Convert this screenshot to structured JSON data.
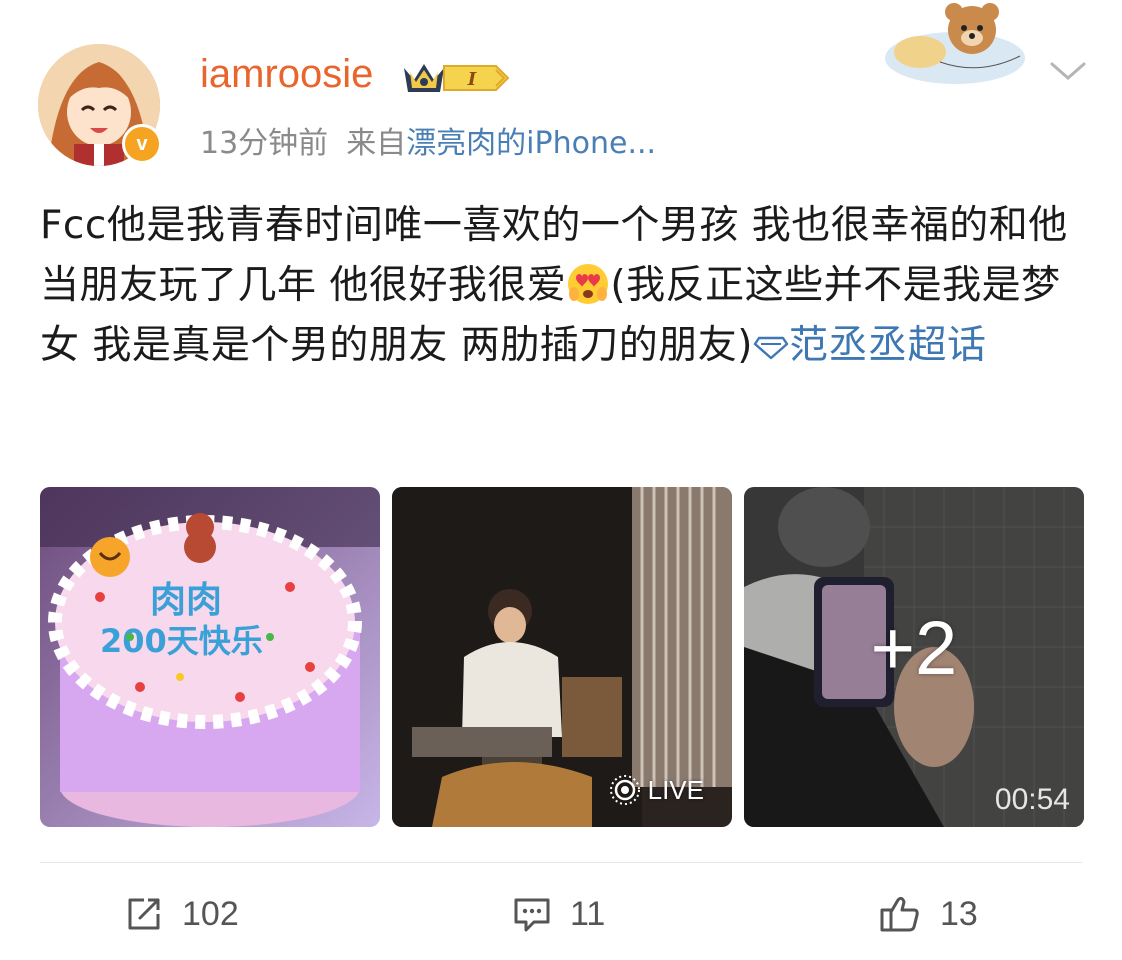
{
  "user": {
    "name": "iamroosie",
    "badge_level": "I",
    "time": "13分钟前",
    "source_prefix": "来自",
    "source_device": "漂亮肉的iPhone..."
  },
  "post": {
    "text_main": "Fcc他是我青春时间唯一喜欢的一个男孩 我也很幸福的和他当朋友玩了几年  他很好我很爱",
    "text_after_emoji": "(我反正这些并不是我是梦女 我是真是个男的朋友 两肋插刀的朋友)",
    "topic": "范丞丞超话"
  },
  "images": {
    "cake_text_line1": "肉肉",
    "cake_text_line2": "200天快乐",
    "live_label": "LIVE",
    "more_count": "+2",
    "video_duration": "00:54"
  },
  "actions": {
    "repost_count": "102",
    "comment_count": "11",
    "like_count": "13"
  },
  "icons": {
    "avatar": "anime-girl-avatar",
    "verified": "orange-v-badge",
    "crown": "crown-level-badge",
    "sticker": "teddy-bear-sticker",
    "chevron": "chevron-down-icon",
    "emoji": "heart-eyes-emoji",
    "topic_icon": "diamond-topic-icon",
    "repost": "repost-icon",
    "comment": "comment-icon",
    "like": "thumbs-up-icon"
  },
  "colors": {
    "username": "#e8652d",
    "link": "#3e78b4",
    "verified": "#f7a322"
  }
}
